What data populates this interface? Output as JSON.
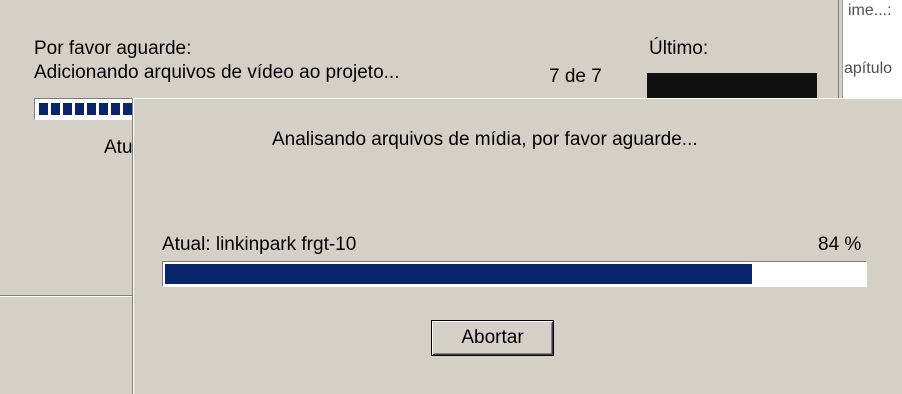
{
  "background_window": {
    "label_top": "ime...:",
    "label_chapter": "apítulo"
  },
  "back_dialog": {
    "message_line1": "Por favor aguarde:",
    "message_line2": "Adicionando arquivos de vídeo ao projeto...",
    "count": "7 de 7",
    "last_label": "Último:",
    "current_label": "Atu",
    "progress_fraction": 0.19
  },
  "front_dialog": {
    "title": "Analisando arquivos de mídia, por favor aguarde...",
    "current": "Atual: linkinpark frgt-10",
    "percent_text": "84 %",
    "progress_fraction": 0.84,
    "abort_label": "Abortar",
    "progress_color": "#0a246a"
  }
}
